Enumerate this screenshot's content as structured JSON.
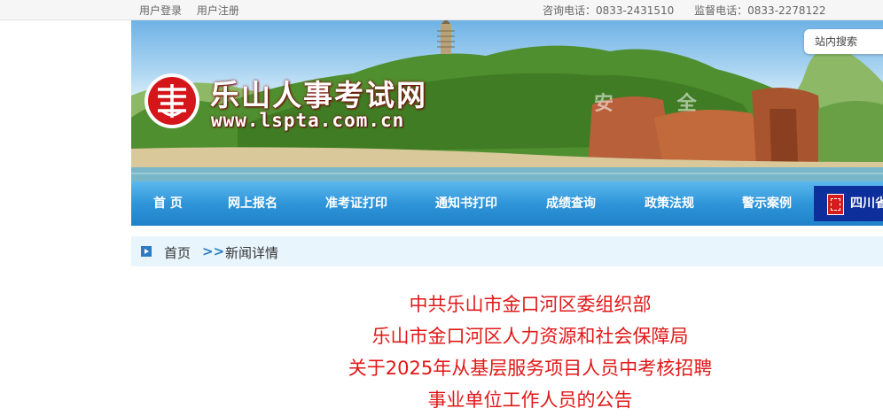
{
  "topbar": {
    "login": "用户登录",
    "register": "用户注册",
    "consult_phone": "咨询电话：0833-2431510",
    "supervise_phone": "监督电话：0833-2278122"
  },
  "banner": {
    "site_name": "乐山人事考试网",
    "site_url": "www.lspta.com.cn",
    "watermark": "安 全",
    "search_placeholder": "站内搜索"
  },
  "nav": {
    "items": [
      "首 页",
      "网上报名",
      "准考证打印",
      "通知书打印",
      "成绩查询",
      "政策法规",
      "警示案例"
    ],
    "badge_label": "四川省"
  },
  "breadcrumb": {
    "home": "首页",
    "separator": ">>",
    "current": "新闻详情"
  },
  "article": {
    "title_lines": [
      "中共乐山市金口河区委组织部",
      "乐山市金口河区人力资源和社会保障局",
      "关于2025年从基层服务项目人员中考核招聘",
      "事业单位工作人员的公告"
    ]
  },
  "colors": {
    "nav_blue": "#2f95d9",
    "title_red": "#e01818",
    "crumb_bg": "#e8f5fd"
  }
}
